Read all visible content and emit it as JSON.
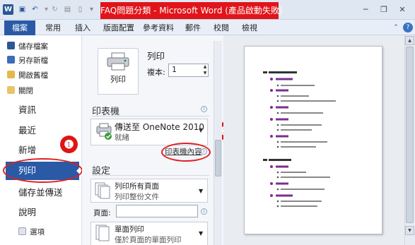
{
  "window": {
    "title": "FAQ問題分類 - Microsoft Word (產品啟動失敗)",
    "app_icon": "W",
    "controls": {
      "minimize": "─",
      "restore": "❐",
      "close": "✕",
      "help": "?"
    }
  },
  "ribbon": {
    "tabs": [
      "檔案",
      "常用",
      "插入",
      "版面配置",
      "參考資料",
      "郵件",
      "校閱",
      "檢視"
    ]
  },
  "backstage_nav": {
    "small_items": [
      {
        "label": "儲存檔案",
        "icon": "save-icon"
      },
      {
        "label": "另存新檔",
        "icon": "save-as-icon"
      },
      {
        "label": "開啟舊檔",
        "icon": "open-folder-icon"
      },
      {
        "label": "關閉",
        "icon": "close-file-icon"
      }
    ],
    "big_items": [
      "資訊",
      "最近",
      "新增",
      "列印",
      "儲存並傳送",
      "說明"
    ],
    "selected": "列印",
    "options_label": "選項"
  },
  "print_panel": {
    "button_label": "列印",
    "heading": "列印",
    "copies_label": "複本:",
    "copies_value": "1",
    "printer_section": "印表機",
    "printer_name": "傳送至 OneNote 2010",
    "printer_status": "就緒",
    "printer_properties": "印表機內容",
    "settings_section": "設定",
    "setting_1_title": "列印所有頁面",
    "setting_1_sub": "列印整份文件",
    "pages_label": "頁面:",
    "pages_value": "",
    "setting_2_title": "單面列印",
    "setting_2_sub": "僅於頁面的單面列印"
  },
  "annotations": {
    "badge_1": "❶",
    "badge_2": "❷"
  },
  "colors": {
    "accent": "#2a5aa6",
    "title_highlight": "#e1141a",
    "callout": "#e01414"
  }
}
